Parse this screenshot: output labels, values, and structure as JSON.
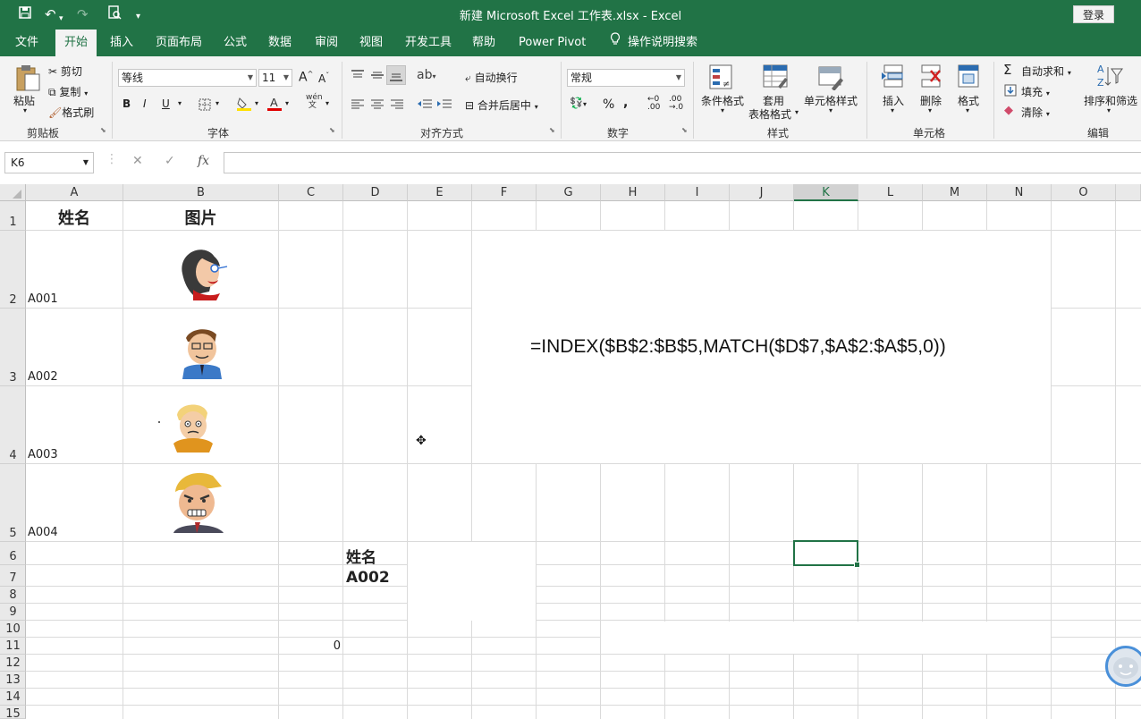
{
  "titlebar": {
    "title": "新建 Microsoft Excel 工作表.xlsx  -  Excel",
    "login": "登录"
  },
  "tabs": [
    "文件",
    "开始",
    "插入",
    "页面布局",
    "公式",
    "数据",
    "审阅",
    "视图",
    "开发工具",
    "帮助",
    "Power Pivot",
    "操作说明搜索"
  ],
  "active_tab": "开始",
  "ribbon": {
    "clipboard": {
      "paste": "粘贴",
      "cut": "剪切",
      "copy": "复制",
      "format_painter": "格式刷",
      "label": "剪贴板"
    },
    "font": {
      "name": "等线",
      "size": "11",
      "bold": "B",
      "italic": "I",
      "underline": "U",
      "label": "字体"
    },
    "alignment": {
      "wrap": "自动换行",
      "merge": "合并后居中",
      "label": "对齐方式"
    },
    "number": {
      "format": "常规",
      "label": "数字"
    },
    "styles": {
      "conditional": "条件格式",
      "table_1": "套用",
      "table_2": "表格格式",
      "cell_styles": "单元格样式",
      "label": "样式"
    },
    "cells": {
      "insert": "插入",
      "delete": "删除",
      "format": "格式",
      "label": "单元格"
    },
    "editing": {
      "autosum": "自动求和",
      "fill": "填充",
      "clear": "清除",
      "sort": "排序和筛选",
      "label": "编辑"
    }
  },
  "formula_bar": {
    "name_box": "K6",
    "fx": "fx",
    "value": ""
  },
  "sheet": {
    "columns": [
      "A",
      "B",
      "C",
      "D",
      "E",
      "F",
      "G",
      "H",
      "I",
      "J",
      "K",
      "L",
      "M",
      "N",
      "O"
    ],
    "selected_column": "K",
    "rows": [
      "1",
      "2",
      "3",
      "4",
      "5",
      "6",
      "7",
      "8",
      "9",
      "10",
      "11",
      "12",
      "13",
      "14",
      "15"
    ],
    "A1": "姓名",
    "B1": "图片",
    "A2": "A001",
    "A3": "A002",
    "A4": "A003",
    "A5": "A004",
    "D6": "姓名",
    "D7": "A002",
    "C11": "0",
    "formula_note": "=INDEX($B$2:$B$5,MATCH($D$7,$A$2:$A$5,0))",
    "active_cell": "K6"
  }
}
